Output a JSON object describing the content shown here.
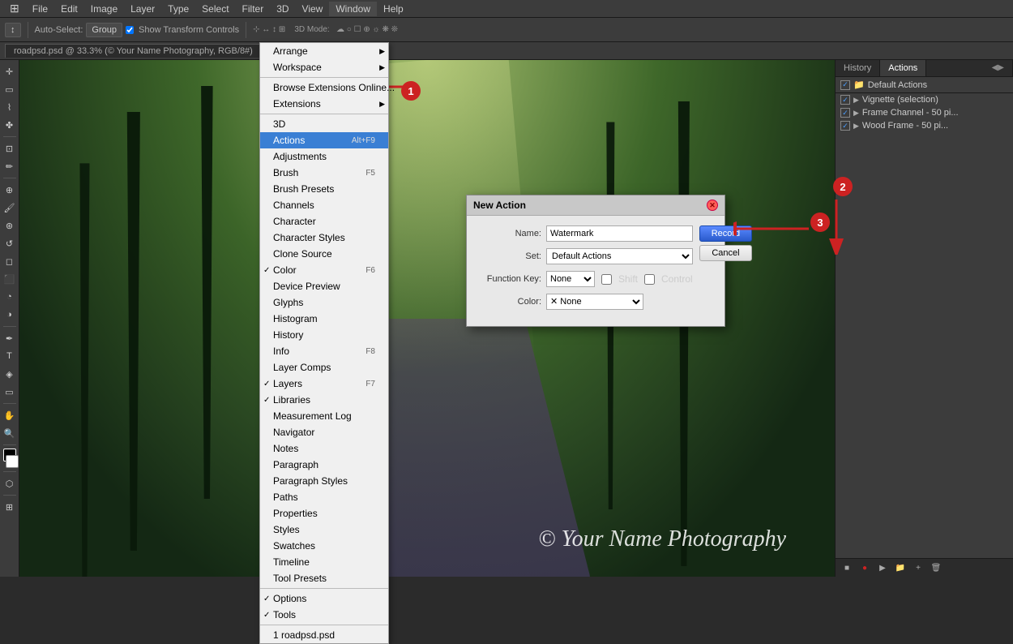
{
  "menubar": {
    "items": [
      "PS",
      "File",
      "Edit",
      "Image",
      "Layer",
      "Type",
      "Select",
      "Filter",
      "3D",
      "View",
      "Window",
      "Help"
    ]
  },
  "toolbar": {
    "auto_select_label": "Auto-Select:",
    "group_label": "Group",
    "show_transform_label": "Show Transform Controls"
  },
  "tab": {
    "label": "roadpsd.psd @ 33.3% (© Your Name Photography, RGB/8#)"
  },
  "window_menu": {
    "title": "Window",
    "items": [
      {
        "label": "Arrange",
        "submenu": true
      },
      {
        "label": "Workspace",
        "submenu": true
      },
      {
        "label": ""
      },
      {
        "label": "Browse Extensions Online..."
      },
      {
        "label": "Extensions",
        "submenu": true
      },
      {
        "label": ""
      },
      {
        "label": "3D"
      },
      {
        "label": "Actions",
        "highlighted": true,
        "shortcut": "Alt+F9",
        "checked": true
      },
      {
        "label": "Adjustments"
      },
      {
        "label": "Brush",
        "shortcut": "F5"
      },
      {
        "label": "Brush Presets"
      },
      {
        "label": "Channels"
      },
      {
        "label": "Character"
      },
      {
        "label": "Character Styles"
      },
      {
        "label": "Clone Source"
      },
      {
        "label": "Color",
        "checked": true,
        "shortcut": "F6"
      },
      {
        "label": "Device Preview"
      },
      {
        "label": "Glyphs"
      },
      {
        "label": "Histogram"
      },
      {
        "label": "History"
      },
      {
        "label": "Info",
        "shortcut": "F8"
      },
      {
        "label": "Layer Comps"
      },
      {
        "label": "Layers",
        "checked": true,
        "shortcut": "F7"
      },
      {
        "label": "Libraries",
        "checked": true
      },
      {
        "label": "Measurement Log"
      },
      {
        "label": "Navigator"
      },
      {
        "label": "Notes"
      },
      {
        "label": "Paragraph"
      },
      {
        "label": "Paragraph Styles"
      },
      {
        "label": "Paths"
      },
      {
        "label": "Properties"
      },
      {
        "label": "Styles"
      },
      {
        "label": "Swatches"
      },
      {
        "label": "Timeline"
      },
      {
        "label": "Tool Presets"
      },
      {
        "label": ""
      },
      {
        "label": "Options",
        "checked": true
      },
      {
        "label": "Tools",
        "checked": true
      },
      {
        "label": ""
      },
      {
        "label": "1 roadpsd.psd"
      }
    ]
  },
  "dialog": {
    "title": "New Action",
    "name_label": "Name:",
    "name_value": "Watermark",
    "set_label": "Set:",
    "set_value": "Default Actions",
    "function_key_label": "Function Key:",
    "function_key_value": "None",
    "shift_label": "Shift",
    "control_label": "Control",
    "color_label": "Color:",
    "color_value": "None",
    "record_button": "Record",
    "cancel_button": "Cancel"
  },
  "actions_panel": {
    "tabs": [
      "History",
      "Actions"
    ],
    "active_tab": "Actions",
    "header": "Default Actions",
    "items": [
      {
        "name": "Default Actions",
        "type": "folder",
        "checked": true
      },
      {
        "name": "Vignette (selection)",
        "type": "action",
        "checked": true
      },
      {
        "name": "Frame Channel - 50 pi...",
        "type": "action",
        "checked": true
      },
      {
        "name": "Wood Frame - 50 pi...",
        "type": "action",
        "checked": true
      }
    ],
    "bottom_buttons": [
      "stop",
      "record",
      "play",
      "new-folder",
      "new-action",
      "delete"
    ]
  },
  "watermark": {
    "text": "© Your Name Photography"
  },
  "steps": {
    "step1": "1",
    "step2": "2",
    "step3": "3"
  }
}
